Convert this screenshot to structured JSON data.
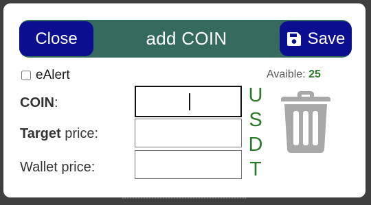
{
  "dialog": {
    "title": "add COIN",
    "close_label": "Close",
    "save_label": "Save",
    "save_icon": "floppy-disk-icon"
  },
  "alert": {
    "label": "eAlert",
    "checked": false
  },
  "available": {
    "label": "Avaible:",
    "value": "25"
  },
  "fields": {
    "coin": {
      "label_bold": "COIN",
      "label_rest": ":",
      "value": ""
    },
    "target": {
      "label_bold": "Target",
      "label_rest": " price:",
      "value": ""
    },
    "wallet": {
      "label_bold": "",
      "label_rest": "Wallet price:",
      "value": ""
    }
  },
  "currency": [
    "U",
    "S",
    "D",
    "T"
  ],
  "delete_icon": "trash-icon",
  "colors": {
    "titlebar": "#356b5e",
    "buttons": "#0b0f8f",
    "accent_green": "#2b7a2b",
    "icon_gray": "#a8a8a8"
  }
}
